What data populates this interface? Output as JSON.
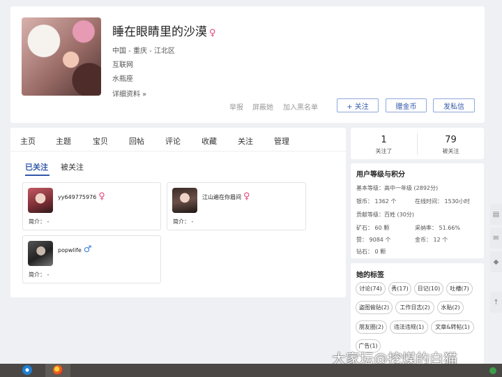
{
  "profile": {
    "name": "睡在眼睛里的沙漠",
    "gender_symbol": "♀",
    "location": "中国 - 重庆 - 江北区",
    "industry": "互联网",
    "zodiac": "水瓶座",
    "details_link": "详细资料 »",
    "report": "举报",
    "block": "屏蔽她",
    "blacklist": "加入黑名单",
    "follow_btn": "+ 关注",
    "gift_btn": "赠金币",
    "message_btn": "发私信"
  },
  "tabs": [
    "主页",
    "主题",
    "宝贝",
    "回帖",
    "评论",
    "收藏",
    "关注",
    "管理"
  ],
  "subtabs": {
    "following": "已关注",
    "followers": "被关注"
  },
  "follow_list": [
    {
      "name": "yy649775976",
      "gender": "♀",
      "intro_label": "简介：",
      "intro": "-"
    },
    {
      "name": "江山遍在你眉间",
      "gender": "♀",
      "intro_label": "简介：",
      "intro": "-"
    },
    {
      "name": "popwlife",
      "gender": "♂",
      "intro_label": "简介：",
      "intro": "-"
    }
  ],
  "stats": [
    {
      "value": "1",
      "label": "关注了"
    },
    {
      "value": "79",
      "label": "被关注"
    }
  ],
  "level": {
    "title": "用户等级与积分",
    "basic": "基本等级：高中一年级 (2892分)",
    "silver": "银币：  1362 个",
    "online": "在线时间：  1530小时",
    "contrib": "贡献等级：百姓 (30分)",
    "ore": "矿石：  60 颗",
    "adopt": "采纳率：  51.66%",
    "likes": "赞：  9084 个",
    "gold": "金币：  12 个",
    "diamond": "钻石：  0 颗"
  },
  "tags_title": "她的标签",
  "tags": [
    "讨论(74)",
    "秀(17)",
    "日记(10)",
    "吐槽(7)",
    "盗图偷贴(2)",
    "工作日志(2)",
    "水贴(2)",
    "朋友圈(2)",
    "违法违规(1)",
    "文章&转帖(1)",
    "广告(1)"
  ],
  "watermark": "大家坛@挖煤的白猫",
  "colors": {
    "accent": "#3157a8",
    "female": "#e5457c",
    "male": "#3b7dd8"
  }
}
